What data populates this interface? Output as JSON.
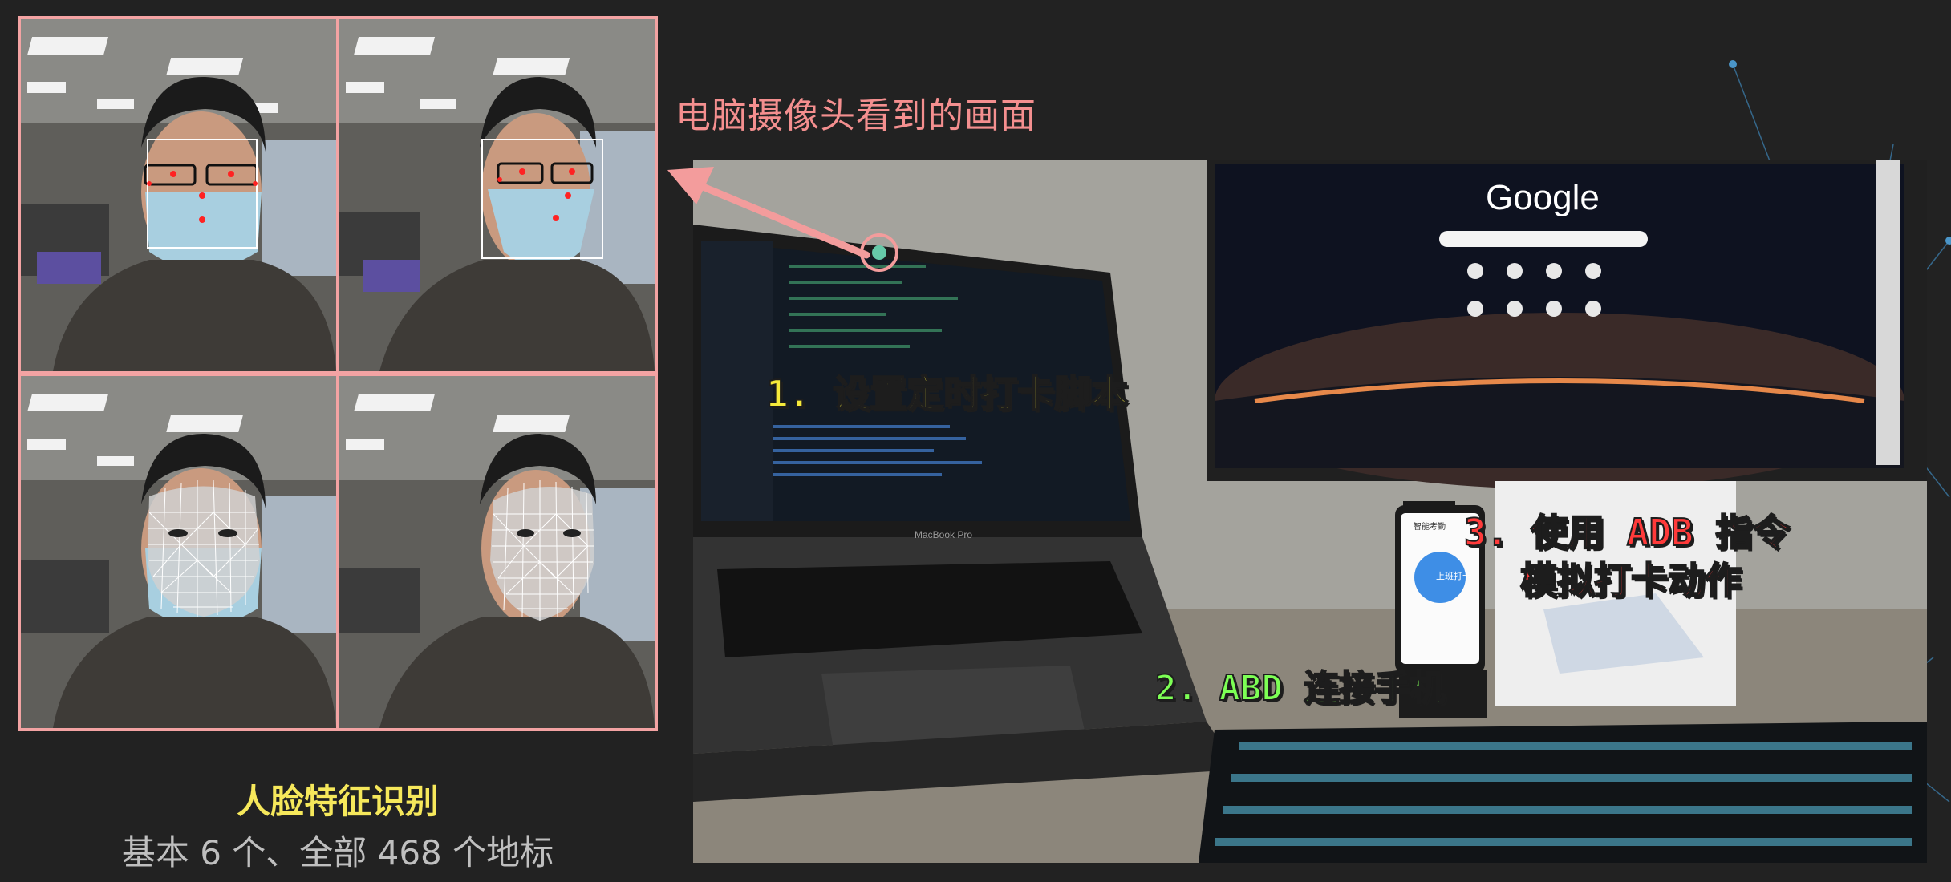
{
  "captions": {
    "camera_view": "电脑摄像头看到的画面",
    "face_recognition_title": "人脸特征识别",
    "face_recognition_sub": "基本 6 个、全部 468 个地标"
  },
  "steps": {
    "step1": "1. 设置定时打卡脚本",
    "step2": "2. ABD 连接手机",
    "step3_line1": "3. 使用 ADB 指令",
    "step3_line2": "模拟打卡动作"
  },
  "screen_text": {
    "google_logo": "Google",
    "laptop_model": "MacBook Pro",
    "phone_button": "上班打卡",
    "phone_header": "智能考勤"
  },
  "colors": {
    "background": "#222222",
    "frame_pink": "#f3a3a3",
    "caption_pink": "#f48f8f",
    "title_yellow": "#f6e85b",
    "sub_gray": "#bfbfbf",
    "step1_yellow": "#f6ea3a",
    "step2_green": "#7dff55",
    "step3_red": "#ff3a3a"
  }
}
